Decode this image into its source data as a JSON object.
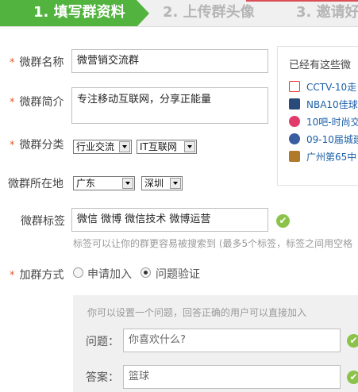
{
  "steps": [
    "1. 填写群资料",
    "2. 上传群头像",
    "3. 邀请好"
  ],
  "form": {
    "name": {
      "label": "微群名称",
      "value": "微营销交流群"
    },
    "intro": {
      "label": "微群简介",
      "value": "专注移动互联网，分享正能量"
    },
    "category": {
      "label": "微群分类",
      "primary": "行业交流",
      "secondary": "IT互联网"
    },
    "location": {
      "label": "微群所在地",
      "province": "广东",
      "city": "深圳"
    },
    "tags": {
      "label": "微群标签",
      "value": "微信 微博 微信技术 微博运营",
      "hint": "标签可以让你的群更容易被搜索到 (最多5个标签，标签之间用空格"
    },
    "join": {
      "label": "加群方式",
      "options": [
        "申请加入",
        "问题验证"
      ],
      "selected": "问题验证"
    },
    "question": {
      "hint": "你可以设置一个问题，回答正确的用户可以直接加入",
      "q_label": "问题：",
      "q_value": "你喜欢什么?",
      "a_label": "答案：",
      "a_value": "篮球"
    }
  },
  "required_mark": "*",
  "check_glyph": "✔",
  "side": {
    "title": "已经有这些微",
    "items": [
      {
        "text": "CCTV-10走",
        "icon": "cctv-icon",
        "color": "#d33"
      },
      {
        "text": "NBA10佳球",
        "icon": "nba-icon",
        "color": "#2a4a7a"
      },
      {
        "text": "10吧-时尚交",
        "icon": "10ba-icon",
        "color": "#e23a6a"
      },
      {
        "text": "09-10届城建",
        "icon": "avatar-icon",
        "color": "#3a5ca0"
      },
      {
        "text": "广州第65中",
        "icon": "avatar-icon",
        "color": "#b07a2a"
      }
    ]
  },
  "colors": {
    "step_active": "#53b33f",
    "ok": "#8bc34a",
    "link": "#1a5fa8"
  }
}
